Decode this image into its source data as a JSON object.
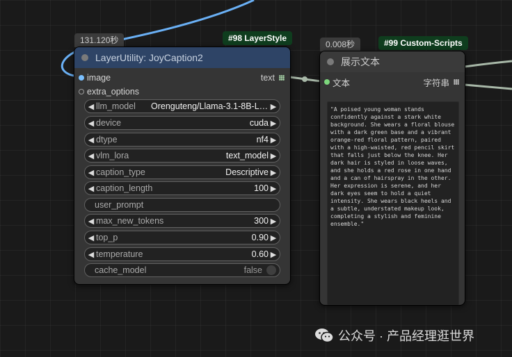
{
  "node98": {
    "time": "131.120秒",
    "tag": "#98 LayerStyle",
    "title": "LayerUtility: JoyCaption2",
    "inputs": [
      {
        "label": "image"
      },
      {
        "label": "extra_options"
      }
    ],
    "output": {
      "label": "text"
    },
    "widgets": {
      "llm_model": {
        "label": "llm_model",
        "value": "Orenguteng/Llama-3.1-8B-Le..."
      },
      "device": {
        "label": "device",
        "value": "cuda"
      },
      "dtype": {
        "label": "dtype",
        "value": "nf4"
      },
      "vlm_lora": {
        "label": "vlm_lora",
        "value": "text_model"
      },
      "caption_type": {
        "label": "caption_type",
        "value": "Descriptive"
      },
      "caption_length": {
        "label": "caption_length",
        "value": "100"
      },
      "user_prompt": {
        "label": "user_prompt"
      },
      "max_new_tokens": {
        "label": "max_new_tokens",
        "value": "300"
      },
      "top_p": {
        "label": "top_p",
        "value": "0.90"
      },
      "temperature": {
        "label": "temperature",
        "value": "0.60"
      },
      "cache_model": {
        "label": "cache_model",
        "value": "false"
      }
    }
  },
  "node99": {
    "time": "0.008秒",
    "tag": "#99 Custom-Scripts",
    "title": "展示文本",
    "input": {
      "label": "文本"
    },
    "output": {
      "label": "字符串"
    },
    "content": "\"A poised young woman stands confidently against a stark white background. She wears a floral blouse with a dark green base and a vibrant orange-red floral pattern, paired with a high-waisted, red pencil skirt that falls just below the knee. Her dark hair is styled in loose waves, and she holds a red rose in one hand and a can of hairspray in the other. Her expression is serene, and her dark eyes seem to hold a quiet intensity. She wears black heels and a subtle, understated makeup look, completing a stylish and feminine ensemble.\""
  },
  "watermark": {
    "text": "公众号 · 产品经理逛世界"
  },
  "colors": {
    "canvas": "#1a1a1a",
    "node_body": "#353535",
    "node98_header": "#2e4466",
    "tag_bg": "#0f3d1e",
    "image_wire": "#6ab0f5",
    "string_wire": "#a8b8a8"
  },
  "icons": {
    "widget_arrows": "triangle-left / triangle-right",
    "output_grid": "dot-grid-icon",
    "watermark_logo": "wechat-icon"
  }
}
